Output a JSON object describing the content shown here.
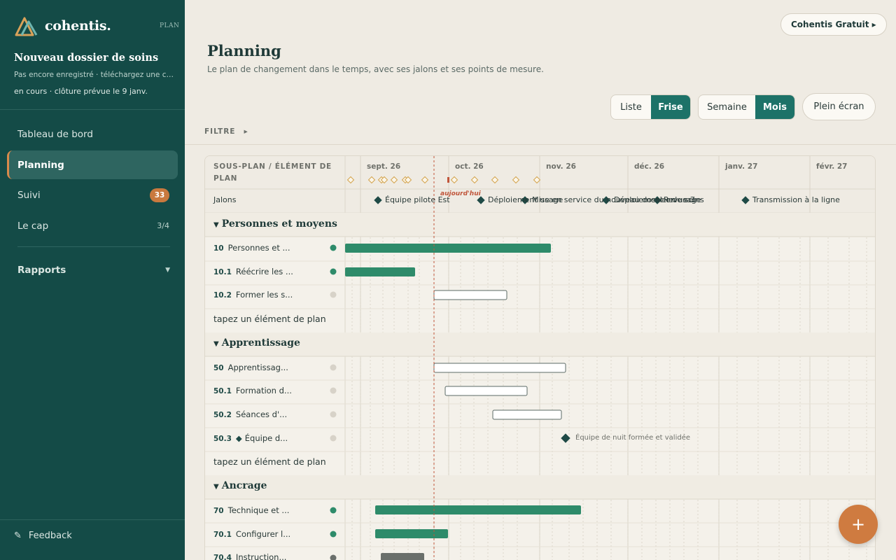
{
  "sidebar": {
    "brand": "cohentis.",
    "plan_tag": "PLAN",
    "folder_title": "Nouveau dossier de soins",
    "folder_note": "Pas encore enregistré · téléchargez une copie ...",
    "folder_status": "en cours · clôture prévue le 9 janv.",
    "nav": [
      {
        "label": "Tableau de bord"
      },
      {
        "label": "Planning",
        "active": true
      },
      {
        "label": "Suivi",
        "badge": "33"
      },
      {
        "label": "Le cap",
        "count": "3/4"
      }
    ],
    "reports": "Rapports",
    "feedback": "Feedback"
  },
  "header": {
    "plan_button": "Cohentis Gratuit ▸",
    "title": "Planning",
    "subtitle": "Le plan de changement dans le temps, avec ses jalons et ses points de mesure."
  },
  "controls": {
    "view_list": "Liste",
    "view_timeline": "Frise",
    "scale_week": "Semaine",
    "scale_month": "Mois",
    "fullscreen": "Plein écran",
    "filter": "FILTRE",
    "filter_arrow": "▸"
  },
  "gantt": {
    "left_header": "SOUS-PLAN / ÉLÉMENT DE PLAN",
    "months": [
      "sept. 26",
      "oct. 26",
      "nov. 26",
      "déc. 26",
      "janv. 27",
      "févr. 27"
    ],
    "today_label": "aujourd'hui",
    "milestones_row_label": "Jalons",
    "milestone_labels": [
      "Équipe pilote Est",
      "Déploiement usage",
      "Mise en service du nouveau dossier de soins",
      "Déploiement en usage",
      "Revue 3",
      "Transmission à la ligne"
    ],
    "add_item_placeholder": "tapez un élément de plan",
    "sections": [
      {
        "title": "Personnes et moyens",
        "rows": [
          {
            "num": "10",
            "name": "Personnes et ..."
          },
          {
            "num": "10.1",
            "name": "Réécrire les ..."
          },
          {
            "num": "10.2",
            "name": "Former les s..."
          }
        ]
      },
      {
        "title": "Apprentissage",
        "rows": [
          {
            "num": "50",
            "name": "Apprentissag..."
          },
          {
            "num": "50.1",
            "name": "Formation d..."
          },
          {
            "num": "50.2",
            "name": "Séances d'..."
          },
          {
            "num": "50.3",
            "name": "Équipe d...",
            "milestone_note": "Équipe de nuit formée et validée"
          }
        ]
      },
      {
        "title": "Ancrage",
        "rows": [
          {
            "num": "70",
            "name": "Technique et ..."
          },
          {
            "num": "70.1",
            "name": "Configurer l..."
          },
          {
            "num": "70.4",
            "name": "Instruction..."
          }
        ]
      }
    ]
  },
  "fab": "+",
  "colors": {
    "sidebar": "#144b47",
    "accent": "#1d7268",
    "bar": "#2e8b6a",
    "today": "#c0553a",
    "badge": "#c9793e"
  }
}
